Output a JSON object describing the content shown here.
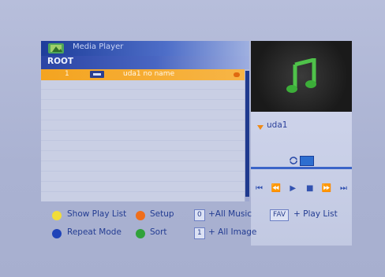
{
  "window": {
    "title": "Media Player",
    "path": "ROOT"
  },
  "file_list": {
    "rows": [
      {
        "index": "1",
        "name": "uda1  no name"
      }
    ]
  },
  "preview": {
    "icon": "music-note-icon",
    "drive_label": "uda1"
  },
  "transport": {
    "buttons": [
      "first-icon",
      "rewind-icon",
      "play-icon",
      "stop-icon",
      "fast-forward-icon",
      "last-icon"
    ]
  },
  "legend": {
    "show_play_list": "Show Play List",
    "setup": "Setup",
    "repeat_mode": "Repeat Mode",
    "sort": "Sort",
    "key_0": "0",
    "all_music": "+All Music",
    "key_fav": "FAV",
    "play_list": "+ Play List",
    "key_1": "1",
    "all_image": "+ All Image"
  },
  "colors": {
    "selected_row": "#f4a420",
    "accent_blue": "#2b44a4",
    "yellow_button": "#f2dd3a",
    "orange_button": "#ef6e1c",
    "blue_button": "#1f43b8",
    "green_button": "#31a23b"
  }
}
